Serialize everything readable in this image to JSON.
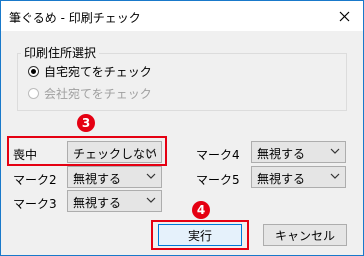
{
  "window": {
    "title": "筆ぐるめ - 印刷チェック"
  },
  "group": {
    "legend": "印刷住所選択",
    "options": [
      {
        "label": "自宅宛てをチェック",
        "selected": true,
        "enabled": true
      },
      {
        "label": "会社宛てをチェック",
        "selected": false,
        "enabled": false
      }
    ]
  },
  "fields": {
    "mochu": {
      "label": "喪中",
      "value": "チェックしない"
    },
    "mark2": {
      "label": "マーク2",
      "value": "無視する"
    },
    "mark3": {
      "label": "マーク3",
      "value": "無視する"
    },
    "mark4": {
      "label": "マーク4",
      "value": "無視する"
    },
    "mark5": {
      "label": "マーク5",
      "value": "無視する"
    }
  },
  "annotations": {
    "step3": "3",
    "step4": "4"
  },
  "buttons": {
    "execute": "実行",
    "cancel": "キャンセル"
  },
  "colors": {
    "highlight": "#e50012",
    "window_border": "#1979ca",
    "dialog_bg": "#f0f0f0"
  },
  "icons": {
    "close": "close-icon",
    "dropdown": "chevron-down-icon",
    "radio": "radio-icon"
  }
}
